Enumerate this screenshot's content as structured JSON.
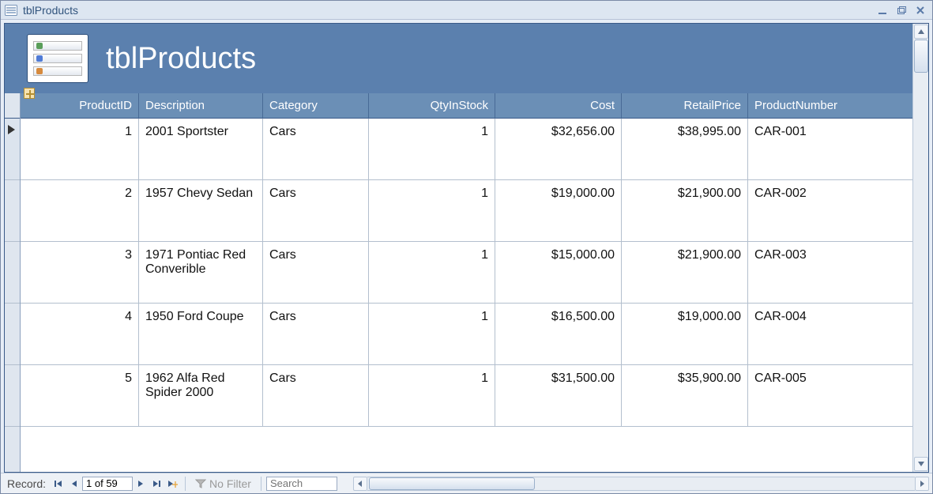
{
  "window": {
    "title": "tblProducts"
  },
  "report": {
    "title": "tblProducts"
  },
  "columns": {
    "product_id": "ProductID",
    "description": "Description",
    "category": "Category",
    "qty": "QtyInStock",
    "cost": "Cost",
    "retail": "RetailPrice",
    "pn": "ProductNumber"
  },
  "rows": [
    {
      "id": "1",
      "desc": "2001 Sportster",
      "cat": "Cars",
      "qty": "1",
      "cost": "$32,656.00",
      "retail": "$38,995.00",
      "pn": "CAR-001"
    },
    {
      "id": "2",
      "desc": "1957 Chevy Sedan",
      "cat": "Cars",
      "qty": "1",
      "cost": "$19,000.00",
      "retail": "$21,900.00",
      "pn": "CAR-002"
    },
    {
      "id": "3",
      "desc": "1971 Pontiac Red Converible",
      "cat": "Cars",
      "qty": "1",
      "cost": "$15,000.00",
      "retail": "$21,900.00",
      "pn": "CAR-003"
    },
    {
      "id": "4",
      "desc": "1950 Ford Coupe",
      "cat": "Cars",
      "qty": "1",
      "cost": "$16,500.00",
      "retail": "$19,000.00",
      "pn": "CAR-004"
    },
    {
      "id": "5",
      "desc": "1962 Alfa Red Spider 2000",
      "cat": "Cars",
      "qty": "1",
      "cost": "$31,500.00",
      "retail": "$35,900.00",
      "pn": "CAR-005"
    }
  ],
  "nav": {
    "label": "Record:",
    "position": "1 of 59",
    "no_filter": "No Filter",
    "search_placeholder": "Search"
  }
}
